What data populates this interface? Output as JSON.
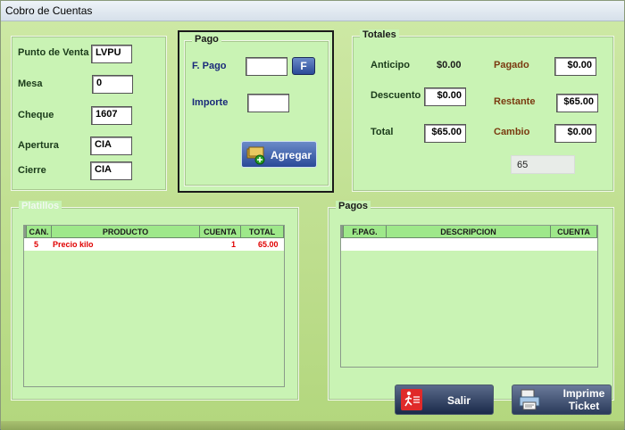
{
  "window": {
    "title": "Cobro de Cuentas"
  },
  "info": {
    "punto_venta_label": "Punto de Venta",
    "punto_venta_value": "LVPU",
    "mesa_label": "Mesa",
    "mesa_value": "0",
    "cheque_label": "Cheque",
    "cheque_value": "1607",
    "apertura_label": "Apertura",
    "apertura_value": "CIA",
    "cierre_label": "Cierre",
    "cierre_value": "CIA"
  },
  "pago": {
    "title": "Pago",
    "f_pago_label": "F. Pago",
    "f_pago_value": "",
    "f_button_label": "F",
    "importe_label": "Importe",
    "importe_value": "",
    "agregar_label": "Agregar"
  },
  "totales": {
    "title": "Totales",
    "anticipo_label": "Anticipo",
    "anticipo_value": "$0.00",
    "descuento_label": "Descuento",
    "descuento_value": "$0.00",
    "total_label": "Total",
    "total_value": "$65.00",
    "pagado_label": "Pagado",
    "pagado_value": "$0.00",
    "restante_label": "Restante",
    "restante_value": "$65.00",
    "cambio_label": "Cambio",
    "cambio_value": "$0.00",
    "extra_value": "65"
  },
  "platillos": {
    "title": "Platillos",
    "columns": [
      "CAN.",
      "PRODUCTO",
      "CUENTA",
      "TOTAL"
    ],
    "rows": [
      {
        "can": "5",
        "producto": "Precio kilo",
        "cuenta": "1",
        "total": "65.00"
      }
    ]
  },
  "pagos": {
    "title": "Pagos",
    "columns": [
      "F.PAG.",
      "DESCRIPCION",
      "CUENTA"
    ]
  },
  "actions": {
    "salir_label": "Salir",
    "imprime_label": "Imprime Ticket"
  },
  "colors": {
    "panel": "#c9f3b4",
    "header": "#9ee88a",
    "row_text": "#e00000"
  },
  "icons": {
    "f_pago": "f-icon",
    "agregar": "money-add-icon",
    "salir": "exit-icon",
    "imprime": "printer-icon"
  }
}
